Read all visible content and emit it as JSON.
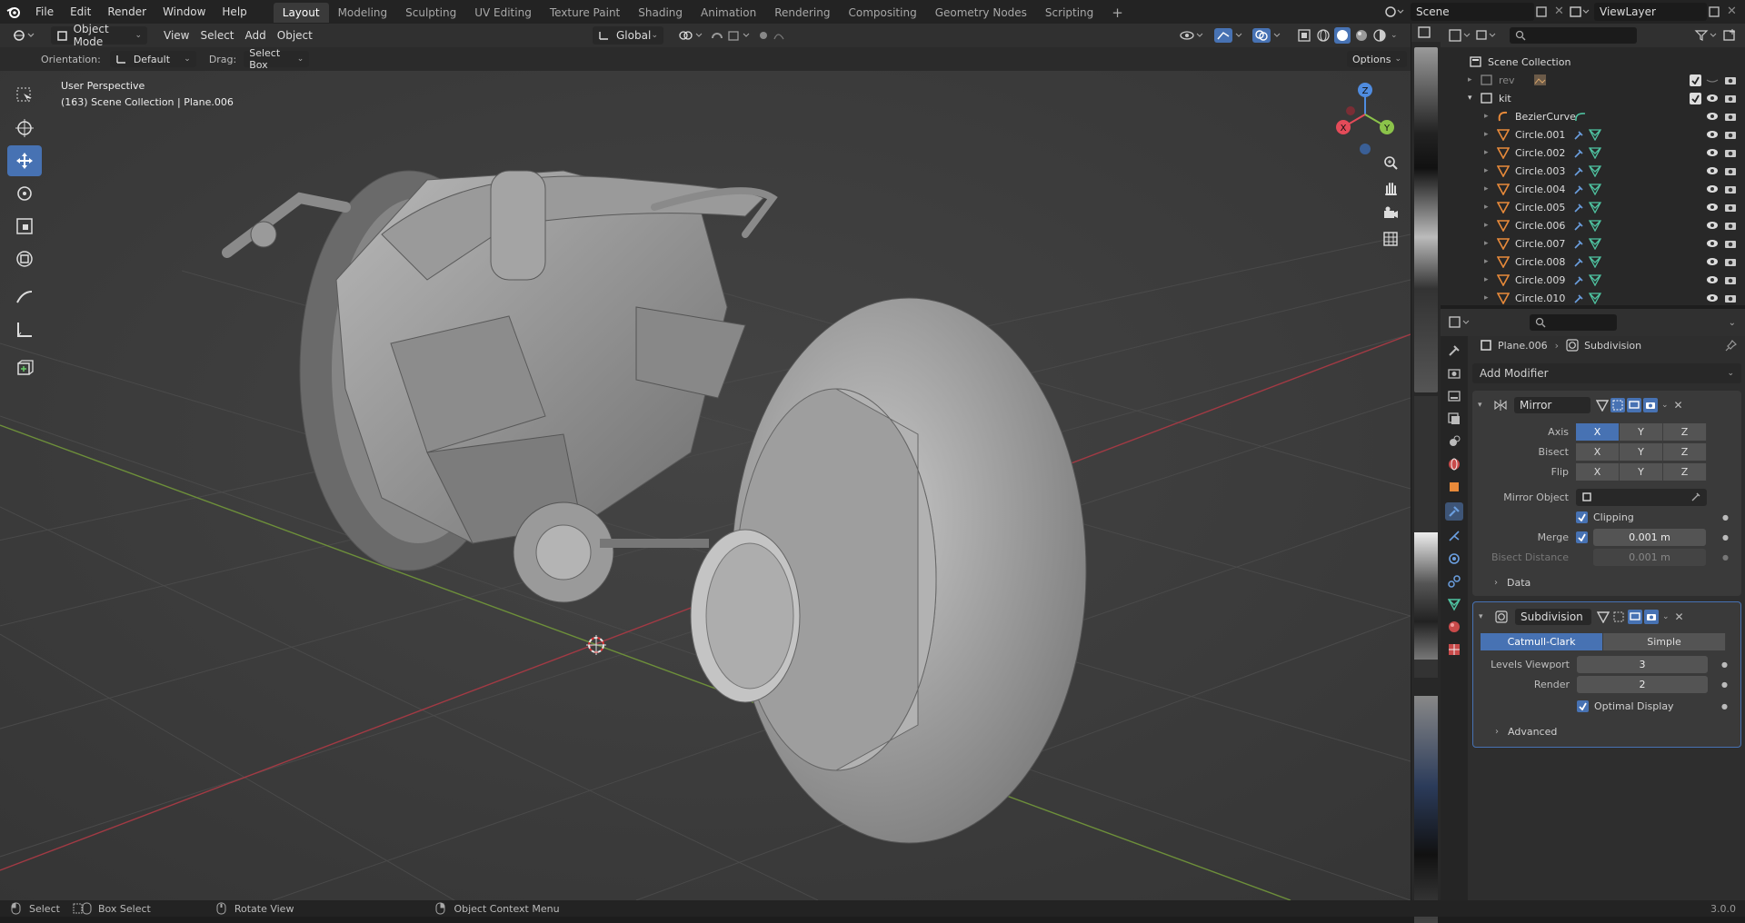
{
  "topbar": {
    "menus": [
      "File",
      "Edit",
      "Render",
      "Window",
      "Help"
    ],
    "workspaces": [
      "Layout",
      "Modeling",
      "Sculpting",
      "UV Editing",
      "Texture Paint",
      "Shading",
      "Animation",
      "Rendering",
      "Compositing",
      "Geometry Nodes",
      "Scripting"
    ],
    "active_workspace": "Layout",
    "add_tab": "+",
    "scene_name": "Scene",
    "view_layer": "ViewLayer"
  },
  "viewport_header": {
    "mode": "Object Mode",
    "menus": [
      "View",
      "Select",
      "Add",
      "Object"
    ],
    "transform_orientation": "Global"
  },
  "tool_settings": {
    "orientation_label": "Orientation:",
    "orientation_value": "Default",
    "drag_label": "Drag:",
    "drag_value": "Select Box",
    "options": "Options"
  },
  "viewport": {
    "view_name": "User Perspective",
    "collection_info": "(163) Scene Collection | Plane.006",
    "gizmo_axes": [
      "X",
      "Y",
      "Z"
    ]
  },
  "outliner": {
    "root": "Scene Collection",
    "items": [
      {
        "name": "rev",
        "depth": 1,
        "type": "collection",
        "disabled": true
      },
      {
        "name": "kit",
        "depth": 1,
        "type": "collection",
        "disabled": false
      },
      {
        "name": "BezierCurve",
        "depth": 2,
        "type": "curve"
      },
      {
        "name": "Circle.001",
        "depth": 2,
        "type": "mesh"
      },
      {
        "name": "Circle.002",
        "depth": 2,
        "type": "mesh"
      },
      {
        "name": "Circle.003",
        "depth": 2,
        "type": "mesh"
      },
      {
        "name": "Circle.004",
        "depth": 2,
        "type": "mesh"
      },
      {
        "name": "Circle.005",
        "depth": 2,
        "type": "mesh"
      },
      {
        "name": "Circle.006",
        "depth": 2,
        "type": "mesh"
      },
      {
        "name": "Circle.007",
        "depth": 2,
        "type": "mesh"
      },
      {
        "name": "Circle.008",
        "depth": 2,
        "type": "mesh"
      },
      {
        "name": "Circle.009",
        "depth": 2,
        "type": "mesh"
      },
      {
        "name": "Circle.010",
        "depth": 2,
        "type": "mesh"
      }
    ]
  },
  "properties": {
    "breadcrumb_object": "Plane.006",
    "breadcrumb_modifier": "Subdivision",
    "add_modifier": "Add Modifier",
    "mirror": {
      "name": "Mirror",
      "axis_label": "Axis",
      "bisect_label": "Bisect",
      "flip_label": "Flip",
      "axes": [
        "X",
        "Y",
        "Z"
      ],
      "mirror_object_label": "Mirror Object",
      "clipping_label": "Clipping",
      "merge_label": "Merge",
      "merge_value": "0.001 m",
      "bisect_distance_label": "Bisect Distance",
      "bisect_distance_value": "0.001 m",
      "data_label": "Data"
    },
    "subdivision": {
      "name": "Subdivision",
      "catmull": "Catmull-Clark",
      "simple": "Simple",
      "levels_viewport_label": "Levels Viewport",
      "levels_viewport": "3",
      "render_label": "Render",
      "render_value": "2",
      "optimal_display": "Optimal Display",
      "advanced": "Advanced"
    }
  },
  "statusbar": {
    "select": "Select",
    "box_select": "Box Select",
    "rotate_view": "Rotate View",
    "context_menu": "Object Context Menu",
    "version": "3.0.0"
  },
  "colors": {
    "accent_blue": "#4772b3",
    "axis_x": "#e44b59",
    "axis_y": "#8bc34a",
    "axis_z": "#4f8ce0",
    "mesh_orange": "#e88a3a"
  }
}
